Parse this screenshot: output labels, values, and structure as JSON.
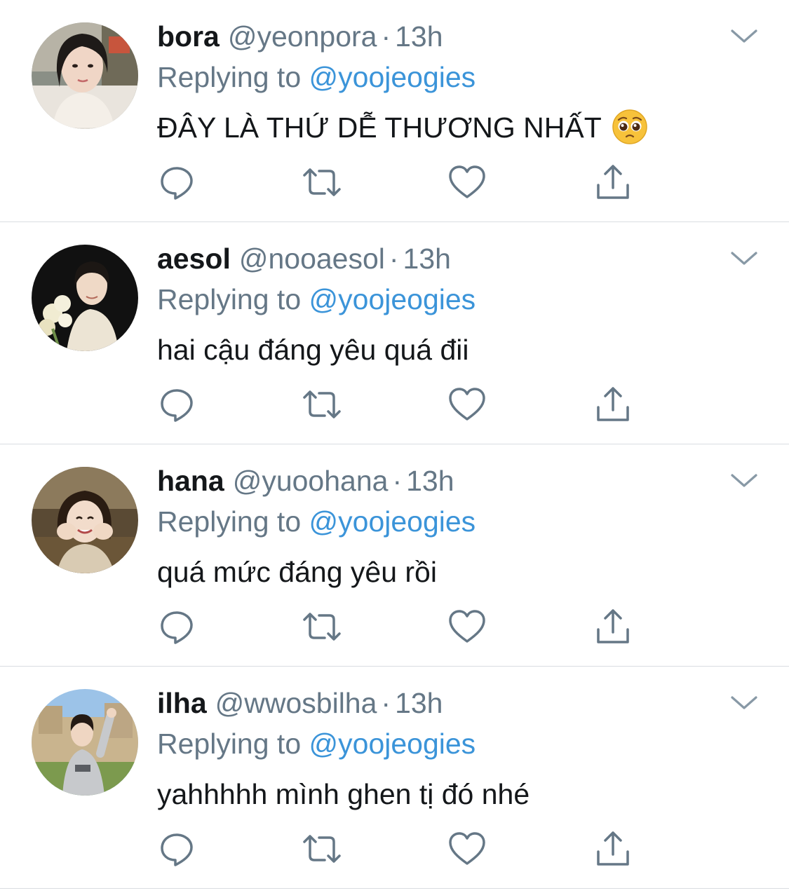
{
  "colors": {
    "name": "#14171a",
    "secondary": "#657786",
    "link": "#3b94d9",
    "divider": "#d9dde1",
    "icon": "#657786"
  },
  "tweets": [
    {
      "display_name": "bora",
      "handle": "@yeonpora",
      "separator": "·",
      "time": "13h",
      "replying_prefix": "Replying to ",
      "replying_to": "@yoojeogies",
      "text": "ĐÂY LÀ THỨ DỄ THƯƠNG NHẤT",
      "emoji": "pleading-face-emoji"
    },
    {
      "display_name": "aesol",
      "handle": "@nooaesol",
      "separator": "·",
      "time": "13h",
      "replying_prefix": "Replying to ",
      "replying_to": "@yoojeogies",
      "text": "hai cậu đáng yêu quá đii"
    },
    {
      "display_name": "hana",
      "handle": "@yuoohana",
      "separator": "·",
      "time": "13h",
      "replying_prefix": "Replying to ",
      "replying_to": "@yoojeogies",
      "text": "quá mức đáng yêu rồi"
    },
    {
      "display_name": "ilha",
      "handle": "@wwosbilha",
      "separator": "·",
      "time": "13h",
      "replying_prefix": "Replying to ",
      "replying_to": "@yoojeogies",
      "text": "yahhhhh mình ghen tị đó nhé"
    }
  ],
  "icons": {
    "reply": "reply-icon",
    "retweet": "retweet-icon",
    "like": "heart-icon",
    "share": "share-icon",
    "menu": "chevron-down-icon"
  }
}
